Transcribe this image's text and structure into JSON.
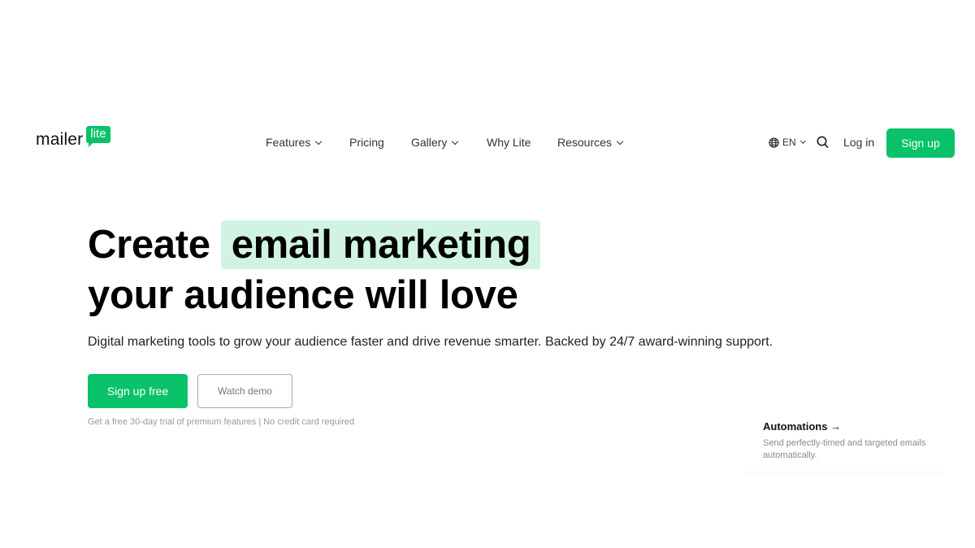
{
  "brand": {
    "logo_word": "mailer",
    "logo_badge": "lite",
    "accent_color": "#09c269",
    "highlight_color": "#d1f3e1"
  },
  "nav": {
    "items": [
      {
        "label": "Features",
        "has_dropdown": true
      },
      {
        "label": "Pricing",
        "has_dropdown": false
      },
      {
        "label": "Gallery",
        "has_dropdown": true
      },
      {
        "label": "Why Lite",
        "has_dropdown": false
      },
      {
        "label": "Resources",
        "has_dropdown": true
      }
    ],
    "language": "EN",
    "login_label": "Log in",
    "signup_label": "Sign up",
    "icons": {
      "language": "globe-icon",
      "search": "search-icon",
      "dropdown": "chevron-down-icon"
    }
  },
  "hero": {
    "title_prefix": "Create",
    "title_highlight": "email marketing",
    "title_line2": "your audience will love",
    "subtitle": "Digital marketing tools to grow your audience faster and drive revenue smarter. Backed by 24/7 award-winning support.",
    "primary_cta": "Sign up free",
    "secondary_cta": "Watch demo",
    "note": "Get a free 30-day trial of premium features | No credit card required"
  },
  "feature_card": {
    "title": "Automations",
    "arrow": "→",
    "description": "Send perfectly-timed and targeted emails automatically."
  }
}
